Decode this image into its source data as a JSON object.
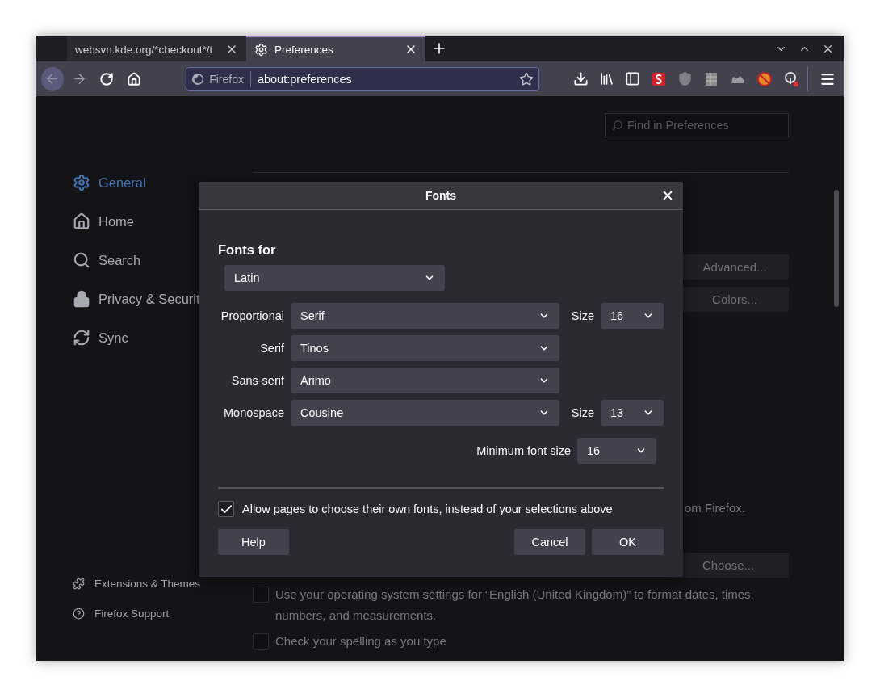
{
  "tabs": [
    {
      "title": "websvn.kde.org/*checkout*/t",
      "selected": false
    },
    {
      "title": "Preferences",
      "selected": true
    }
  ],
  "url_bar": {
    "identity": "Firefox",
    "url": "about:preferences"
  },
  "sidebar": {
    "items": [
      {
        "label": "General",
        "kind": "general",
        "selected": true
      },
      {
        "label": "Home",
        "kind": "home",
        "selected": false
      },
      {
        "label": "Search",
        "kind": "search",
        "selected": false
      },
      {
        "label": "Privacy & Securit",
        "kind": "privacy",
        "selected": false
      },
      {
        "label": "Sync",
        "kind": "sync",
        "selected": false
      }
    ],
    "footer": [
      {
        "label": "Extensions & Themes",
        "kind": "extensions"
      },
      {
        "label": "Firefox Support",
        "kind": "support"
      }
    ]
  },
  "search": {
    "placeholder": "Find in Preferences"
  },
  "page": {
    "buttons": [
      {
        "label": "Advanced..."
      },
      {
        "label": "Colors..."
      }
    ],
    "fragment": "om Firefox.",
    "choose_button": {
      "label": "Choose..."
    },
    "checkboxes": [
      {
        "label": "Use your operating system settings for “English (United Kingdom)” to format dates, times, numbers, and measurements.",
        "checked": false
      },
      {
        "label": "Check your spelling as you type",
        "checked": false
      }
    ]
  },
  "dialog": {
    "title": "Fonts",
    "heading": "Fonts for",
    "language": "Latin",
    "rows": [
      {
        "label": "Proportional",
        "value": "Serif",
        "size_label": "Size",
        "size": "16"
      },
      {
        "label": "Serif",
        "value": "Tinos"
      },
      {
        "label": "Sans-serif",
        "value": "Arimo"
      },
      {
        "label": "Monospace",
        "value": "Cousine",
        "size_label": "Size",
        "size": "13"
      }
    ],
    "minimum": {
      "label": "Minimum font size",
      "value": "16"
    },
    "allow": {
      "label": "Allow pages to choose their own fonts, instead of your selections above",
      "checked": true
    },
    "buttons": [
      {
        "label": "Help",
        "kind": "help"
      },
      {
        "label": "Cancel",
        "kind": "cancel"
      },
      {
        "label": "OK",
        "kind": "ok"
      }
    ]
  }
}
